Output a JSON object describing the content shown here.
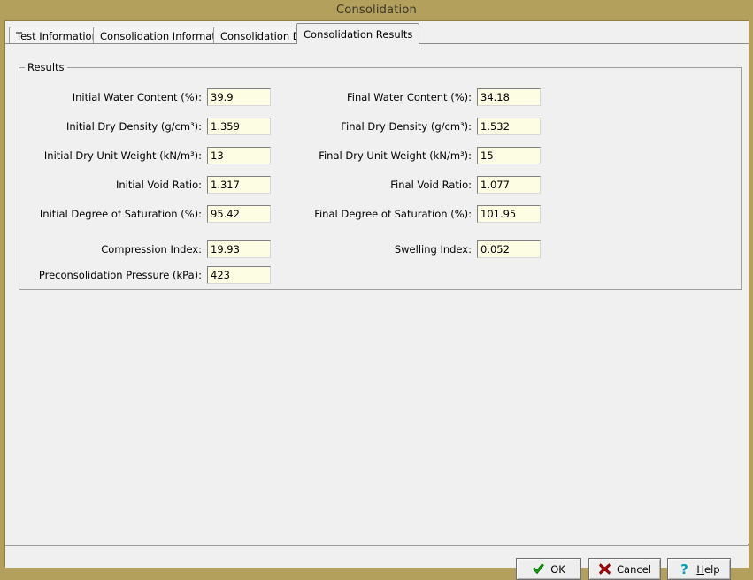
{
  "window": {
    "title": "Consolidation",
    "titlebar_color": "#b3a05c",
    "client_bg": "#f0f0f0",
    "input_bg": "#fdfde4"
  },
  "tabs": [
    {
      "label": "Test Information",
      "active": false
    },
    {
      "label": "Consolidation Information",
      "active": false
    },
    {
      "label": "Consolidation Data",
      "active": false
    },
    {
      "label": "Consolidation Results",
      "active": true
    }
  ],
  "results_group": {
    "title": "Results",
    "left_fields": [
      {
        "label": "Initial Water Content (%):",
        "value": "39.9"
      },
      {
        "label": "Initial Dry Density (g/cm³):",
        "value": "1.359"
      },
      {
        "label": "Initial Dry Unit Weight (kN/m³):",
        "value": "13"
      },
      {
        "label": "Initial Void Ratio:",
        "value": "1.317"
      },
      {
        "label": "Initial Degree of Saturation (%):",
        "value": "95.42"
      },
      {
        "label": "Compression Index:",
        "value": "19.93"
      },
      {
        "label": "Preconsolidation Pressure (kPa):",
        "value": "423"
      }
    ],
    "right_fields": [
      {
        "label": "Final Water Content (%):",
        "value": "34.18"
      },
      {
        "label": "Final Dry Density (g/cm³):",
        "value": "1.532"
      },
      {
        "label": "Final Dry Unit Weight (kN/m³):",
        "value": "15"
      },
      {
        "label": "Final Void Ratio:",
        "value": "1.077"
      },
      {
        "label": "Final Degree of Saturation (%):",
        "value": "101.95"
      },
      {
        "label": "Swelling Index:",
        "value": "0.052"
      }
    ]
  },
  "buttons": {
    "ok": {
      "label": "OK",
      "icon": "green-check-icon",
      "icon_color": "#10a010"
    },
    "cancel": {
      "label": "Cancel",
      "icon": "red-x-icon",
      "icon_color": "#b30000"
    },
    "help": {
      "label_prefix": "H",
      "label_rest": "elp",
      "icon": "question-mark-icon",
      "icon_color": "#00a0b4"
    }
  }
}
